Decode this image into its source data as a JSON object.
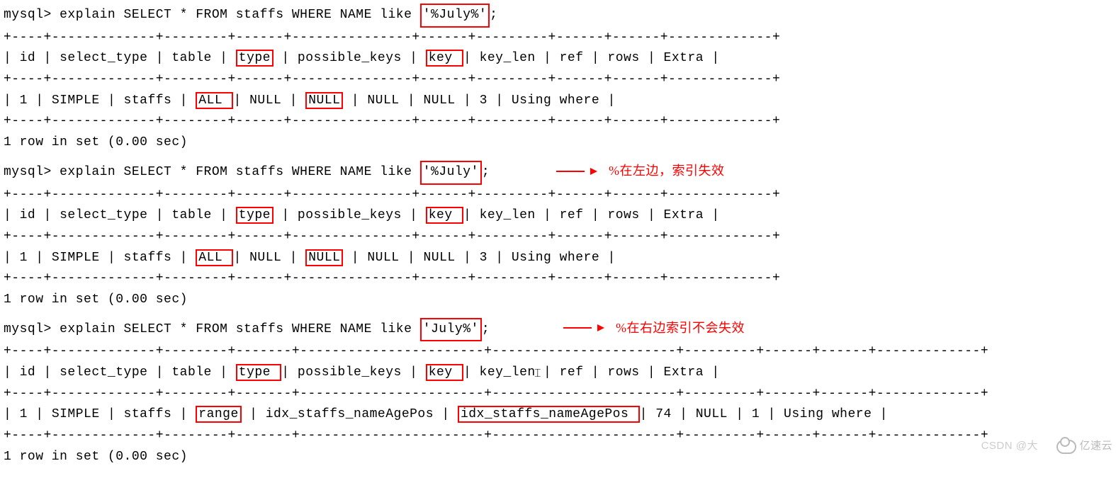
{
  "prompt": "mysql>",
  "row_footer": "1 row in set (0.00 sec)",
  "blocks": [
    {
      "sql_pre": " explain SELECT * FROM staffs WHERE NAME like ",
      "pattern": "'%July%'",
      "sql_post": ";",
      "annotation": "",
      "sep1": "+----+-------------+--------+------+---------------+------+---------+------+------+-------------+",
      "hdr": {
        "c1": "| id ",
        "c2": "| select_type ",
        "c3": "| table  ",
        "c4_pre": "| ",
        "c4": "type",
        "c4_post": " ",
        "c5": "| possible_keys ",
        "c6_pre": "| ",
        "c6": "key ",
        "c6_post": " ",
        "c7": "| key_len ",
        "c8": "| ref  ",
        "c9": "| rows ",
        "c10": "| Extra       |"
      },
      "row": {
        "c1": "|  1 ",
        "c2": "| SIMPLE      ",
        "c3": "| staffs ",
        "c4_pre": "| ",
        "c4": "ALL ",
        "c4_post": " ",
        "c5": "| NULL          ",
        "c6_pre": "| ",
        "c6": "NULL",
        "c6_post": " ",
        "c7": "| NULL    ",
        "c8": "| NULL ",
        "c9": "|    3 ",
        "c10": "| Using where |"
      }
    },
    {
      "sql_pre": " explain SELECT * FROM staffs WHERE NAME like ",
      "pattern": "'%July'",
      "sql_post": ";",
      "annotation": "%在左边，索引失效",
      "sep1": "+----+-------------+--------+------+---------------+------+---------+------+------+-------------+",
      "hdr": {
        "c1": "| id ",
        "c2": "| select_type ",
        "c3": "| table  ",
        "c4_pre": "| ",
        "c4": "type",
        "c4_post": " ",
        "c5": "| possible_keys ",
        "c6_pre": "| ",
        "c6": "key ",
        "c6_post": " ",
        "c7": "| key_len ",
        "c8": "| ref  ",
        "c9": "| rows ",
        "c10": "| Extra       |"
      },
      "row": {
        "c1": "|  1 ",
        "c2": "| SIMPLE      ",
        "c3": "| staffs ",
        "c4_pre": "| ",
        "c4": "ALL ",
        "c4_post": " ",
        "c5": "| NULL          ",
        "c6_pre": "| ",
        "c6": "NULL",
        "c6_post": " ",
        "c7": "| NULL    ",
        "c8": "| NULL ",
        "c9": "|    3 ",
        "c10": "| Using where |"
      }
    },
    {
      "sql_pre": " explain SELECT * FROM staffs WHERE NAME like ",
      "pattern": "'July%'",
      "sql_post": ";",
      "annotation": "%在右边索引不会失效",
      "sep1": "+----+-------------+--------+-------+-----------------------+-----------------------+---------+------+------+-------------+",
      "hdr": {
        "c1": "| id ",
        "c2": "| select_type ",
        "c3": "| table  ",
        "c4_pre": "| ",
        "c4": "type ",
        "c4_post": " ",
        "c5": "| possible_keys         ",
        "c6_pre": "| ",
        "c6": "key                   ",
        "c6_post": "",
        "c7": "| key_len ",
        "c8": "| ref  ",
        "c9": "| rows ",
        "c10": "| Extra       |"
      },
      "row": {
        "c1": "|  1 ",
        "c2": "| SIMPLE      ",
        "c3": "| staffs ",
        "c4_pre": "| ",
        "c4": "range",
        "c4_post": " ",
        "c5": "| idx_staffs_nameAgePos ",
        "c6_pre": "| ",
        "c6": "idx_staffs_nameAgePos ",
        "c6_post": "",
        "c7": "| 74      ",
        "c8": "| NULL ",
        "c9": "|    1 ",
        "c10": "| Using where |"
      }
    }
  ],
  "watermark_csdn": "CSDN @大",
  "watermark_yisu": "亿速云"
}
